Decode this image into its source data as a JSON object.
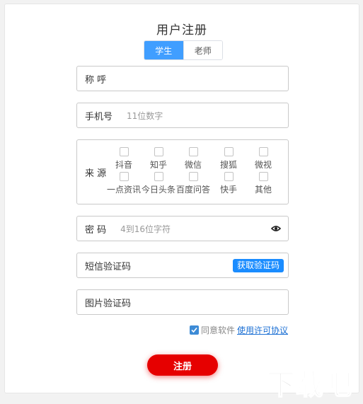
{
  "page": {
    "title": "用户注册"
  },
  "tabs": [
    {
      "label": "学生",
      "active": true
    },
    {
      "label": "老师",
      "active": false
    }
  ],
  "fields": {
    "name": {
      "label": "称 呼"
    },
    "phone": {
      "label": "手机号",
      "placeholder": "11位数字"
    },
    "source": {
      "label": "来 源",
      "options": [
        "抖音",
        "知乎",
        "微信",
        "搜狐",
        "微视",
        "一点资讯",
        "今日头条",
        "百度问答",
        "快手",
        "其他"
      ]
    },
    "password": {
      "label": "密 码",
      "placeholder": "4到16位字符",
      "icon": "eye-icon"
    },
    "sms": {
      "label": "短信验证码",
      "button": "获取验证码"
    },
    "captcha": {
      "label": "图片验证码"
    }
  },
  "agreement": {
    "text": "同意软件",
    "link": "使用许可协议",
    "checked": true
  },
  "submit": {
    "label": "注册"
  },
  "watermark": {
    "text": "下载吧"
  },
  "colors": {
    "accent": "#409eff",
    "submit": "#e60000",
    "link": "#1a6fd4",
    "sms_button": "#1a8cff"
  }
}
